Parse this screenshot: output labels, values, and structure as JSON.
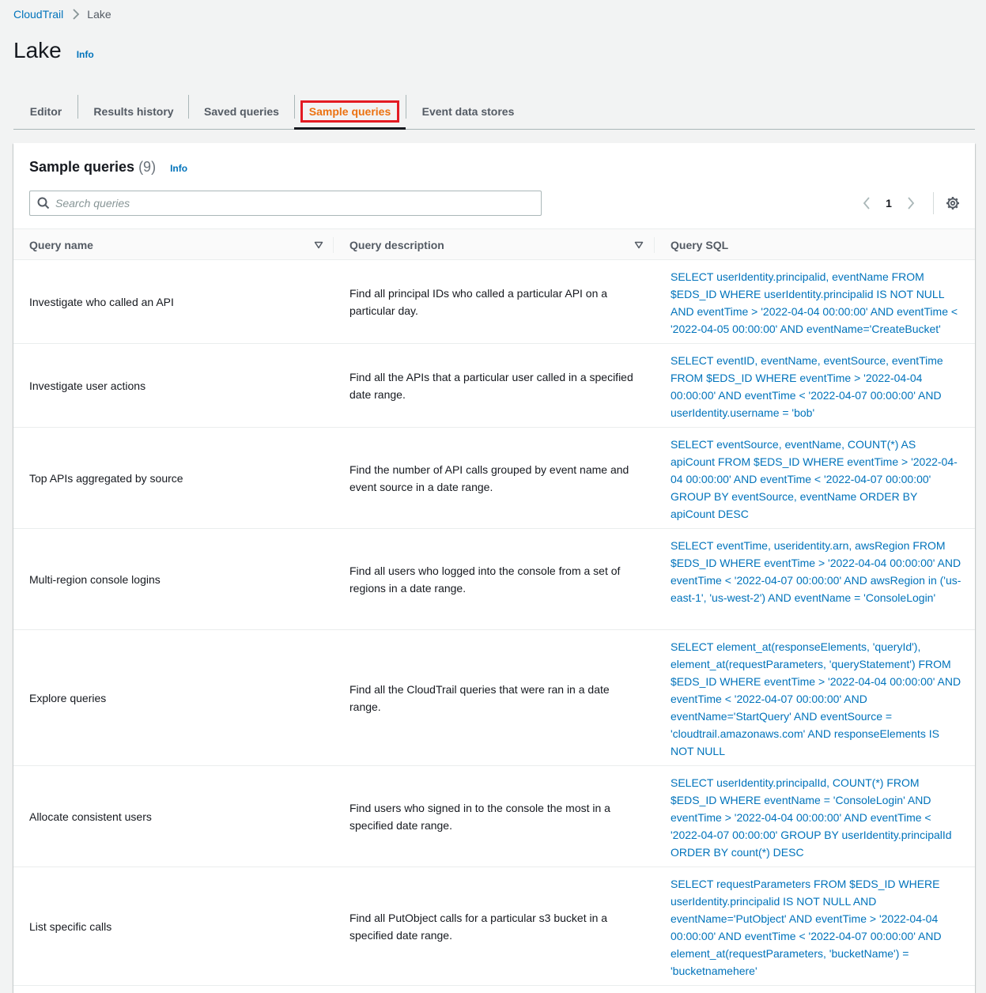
{
  "breadcrumb": {
    "root": "CloudTrail",
    "current": "Lake"
  },
  "page": {
    "title": "Lake",
    "info": "Info"
  },
  "tabs": [
    {
      "label": "Editor"
    },
    {
      "label": "Results history"
    },
    {
      "label": "Saved queries"
    },
    {
      "label": "Sample queries"
    },
    {
      "label": "Event data stores"
    }
  ],
  "active_tab": "Sample queries",
  "panel": {
    "title": "Sample queries",
    "count": "(9)",
    "info": "Info",
    "search_placeholder": "Search queries",
    "current_page": "1"
  },
  "table": {
    "columns": [
      "Query name",
      "Query description",
      "Query SQL"
    ],
    "rows": [
      {
        "name": "Investigate who called an API",
        "description": "Find all principal IDs who called a particular API on a particular day.",
        "sql": "SELECT userIdentity.principalid, eventName FROM $EDS_ID WHERE userIdentity.principalid IS NOT NULL AND eventTime > '2022-04-04 00:00:00' AND eventTime < '2022-04-05 00:00:00' AND eventName='CreateBucket'"
      },
      {
        "name": "Investigate user actions",
        "description": "Find all the APIs that a particular user called in a specified date range.",
        "sql": "SELECT eventID, eventName, eventSource, eventTime FROM $EDS_ID WHERE eventTime > '2022-04-04 00:00:00' AND eventTime < '2022-04-07 00:00:00' AND userIdentity.username = 'bob'"
      },
      {
        "name": "Top APIs aggregated by source",
        "description": "Find the number of API calls grouped by event name and event source in a date range.",
        "sql": "SELECT eventSource, eventName, COUNT(*) AS apiCount FROM $EDS_ID WHERE eventTime > '2022-04-04 00:00:00' AND eventTime < '2022-04-07 00:00:00' GROUP BY eventSource, eventName ORDER BY apiCount DESC"
      },
      {
        "name": "Multi-region console logins",
        "description": "Find all users who logged into the console from a set of regions in a date range.",
        "sql": "SELECT eventTime, useridentity.arn, awsRegion FROM $EDS_ID WHERE eventTime > '2022-04-04 00:00:00' AND eventTime < '2022-04-07 00:00:00' AND awsRegion in ('us-east-1', 'us-west-2') AND eventName = 'ConsoleLogin'"
      },
      {
        "name": "Explore queries",
        "description": "Find all the CloudTrail queries that were ran in a date range.",
        "sql": "SELECT element_at(responseElements, 'queryId'), element_at(requestParameters, 'queryStatement') FROM $EDS_ID WHERE eventTime > '2022-04-04 00:00:00' AND eventTime < '2022-04-07 00:00:00' AND eventName='StartQuery' AND eventSource = 'cloudtrail.amazonaws.com' AND responseElements IS NOT NULL"
      },
      {
        "name": "Allocate consistent users",
        "description": "Find users who signed in to the console the most in a specified date range.",
        "sql": "SELECT userIdentity.principalId, COUNT(*) FROM $EDS_ID WHERE eventName = 'ConsoleLogin' AND eventTime > '2022-04-04 00:00:00' AND eventTime < '2022-04-07 00:00:00' GROUP BY userIdentity.principalId ORDER BY count(*) DESC"
      },
      {
        "name": "List specific calls",
        "description": "Find all PutObject calls for a particular s3 bucket in a specified date range.",
        "sql": "SELECT requestParameters FROM $EDS_ID WHERE userIdentity.principalid IS NOT NULL AND eventName='PutObject' AND eventTime > '2022-04-04 00:00:00' AND eventTime < '2022-04-07 00:00:00' AND element_at(requestParameters, 'bucketName') = 'bucketnamehere'"
      }
    ]
  },
  "colors": {
    "link": "#0073bb",
    "active_tab": "#ec7211",
    "highlight_box": "#e31b23"
  },
  "icons": [
    "chevron-right-icon",
    "search-icon",
    "chevron-left-icon",
    "settings-icon",
    "sort-caret-icon"
  ]
}
